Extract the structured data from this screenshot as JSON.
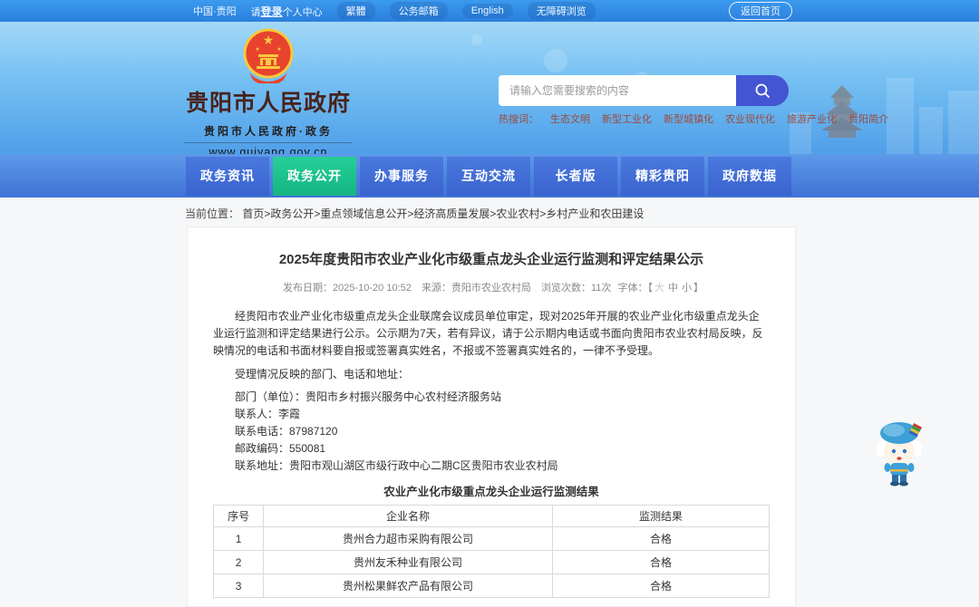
{
  "topbar": {
    "region": "中国·贵阳",
    "login": {
      "pre": "请",
      "link": "登录",
      "post": "个人中心"
    },
    "items": [
      "繁體",
      "公务邮箱",
      "English",
      "无障碍浏览"
    ],
    "home_button": "返回首页"
  },
  "header": {
    "logo": {
      "title": "贵阳市人民政府",
      "subtitle": "贵阳市人民政府·政务",
      "url": "www.guiyang.gov.cn"
    },
    "search": {
      "placeholder": "请输入您需要搜索的内容"
    },
    "hot_search": {
      "label": "热搜词：",
      "words": [
        "生态文明",
        "新型工业化",
        "新型城镇化",
        "农业现代化",
        "旅游产业化",
        "贵阳简介"
      ]
    }
  },
  "nav": {
    "items": [
      "政务资讯",
      "政务公开",
      "办事服务",
      "互动交流",
      "长者版",
      "精彩贵阳",
      "政府数据"
    ],
    "active": "政务公开"
  },
  "breadcrumb": {
    "label": "当前位置：",
    "path": "首页>政务公开>重点领域信息公开>经济高质量发展>农业农村>乡村产业和农田建设"
  },
  "article": {
    "title": "2025年度贵阳市农业产业化市级重点龙头企业运行监测和评定结果公示",
    "meta": {
      "publish": "发布日期：2025-10-20 10:52",
      "source": "来源：贵阳市农业农村局",
      "views": "浏览次数：11次",
      "font_label": "字体：【",
      "font_large": "大",
      "font_medium": "中",
      "font_small": "小",
      "font_close": "】"
    },
    "paragraphs": {
      "p1": "经贵阳市农业产业化市级重点龙头企业联席会议成员单位审定，现对2025年开展的农业产业化市级重点龙头企业运行监测和评定结果进行公示。公示期为7天，若有异议，请于公示期内电话或书面向贵阳市农业农村局反映，反映情况的电话和书面材料要自报或签署真实姓名，不报或不签署真实姓名的，一律不予受理。",
      "p2": "受理情况反映的部门、电话和地址：",
      "dept": "部门（单位）：贵阳市乡村振兴服务中心农村经济服务站",
      "contact": "联系人：李霞",
      "phone": "联系电话：87987120",
      "postcode": "邮政编码：550081",
      "address": "联系地址：贵阳市观山湖区市级行政中心二期C区贵阳市农业农村局"
    },
    "table_title": "农业产业化市级重点龙头企业运行监测结果",
    "table": {
      "headers": [
        "序号",
        "企业名称",
        "监测结果"
      ],
      "rows": [
        [
          "1",
          "贵州合力超市采购有限公司",
          "合格"
        ],
        [
          "2",
          "贵州友禾种业有限公司",
          "合格"
        ],
        [
          "3",
          "贵州松果鲜农产品有限公司",
          "合格"
        ]
      ]
    }
  },
  "colors": {
    "topbar_blue": "#2e86e0",
    "nav_blue": "#3a63cf",
    "nav_active_green": "#16b583",
    "search_button_indigo": "#4355d2",
    "hot_word_red": "#9e4a3a",
    "logo_maroon": "#48231b"
  }
}
